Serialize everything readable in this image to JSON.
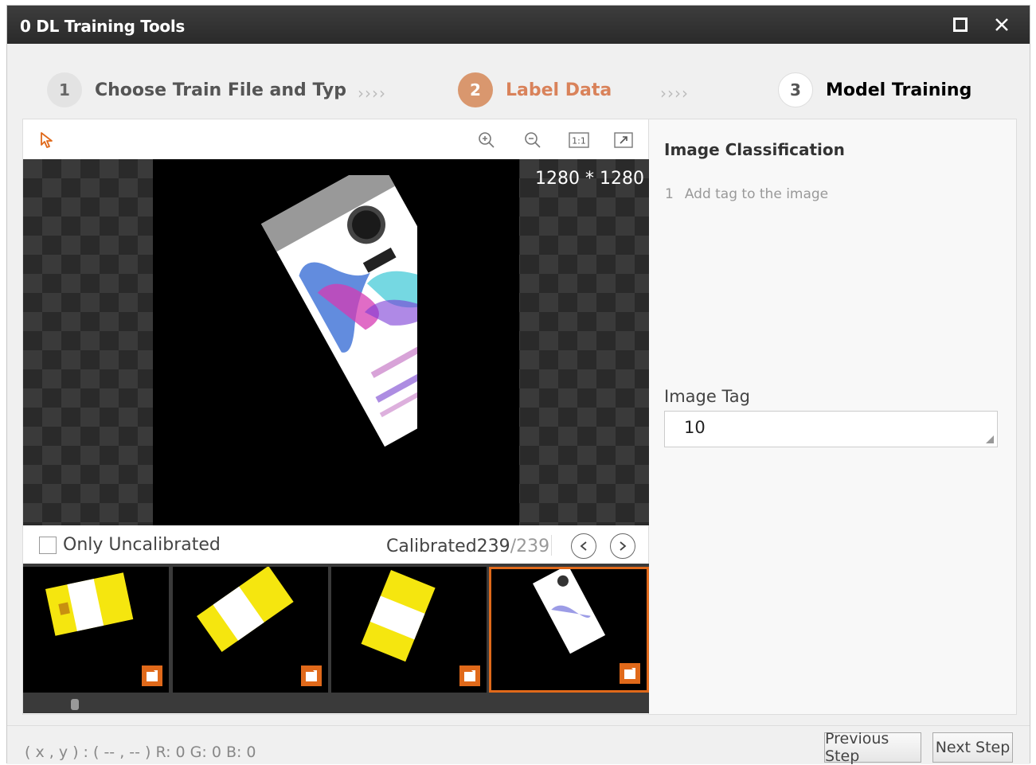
{
  "window": {
    "title": "0 DL Training Tools"
  },
  "steps": [
    {
      "num": "1",
      "label": "Choose Train File and Typ"
    },
    {
      "num": "2",
      "label": "Label Data"
    },
    {
      "num": "3",
      "label": "Model Training"
    }
  ],
  "step_separator": "››››",
  "viewer": {
    "resolution": "1280 * 1280"
  },
  "nav": {
    "only_uncalibrated_label": "Only Uncalibrated",
    "calibrated_prefix": "Calibrated239",
    "calibrated_total": "/239"
  },
  "panel": {
    "title": "Image Classification",
    "step_num": "1",
    "step_text": "Add tag to the image",
    "tag_label": "Image Tag",
    "tag_value": "10"
  },
  "status": {
    "coords": "( x , y ) : ( -- , -- ) R: 0 G: 0 B: 0"
  },
  "buttons": {
    "previous": "Previous Step",
    "next": "Next Step"
  },
  "colors": {
    "accent": "#e0691a",
    "active_step": "#d9825a"
  }
}
